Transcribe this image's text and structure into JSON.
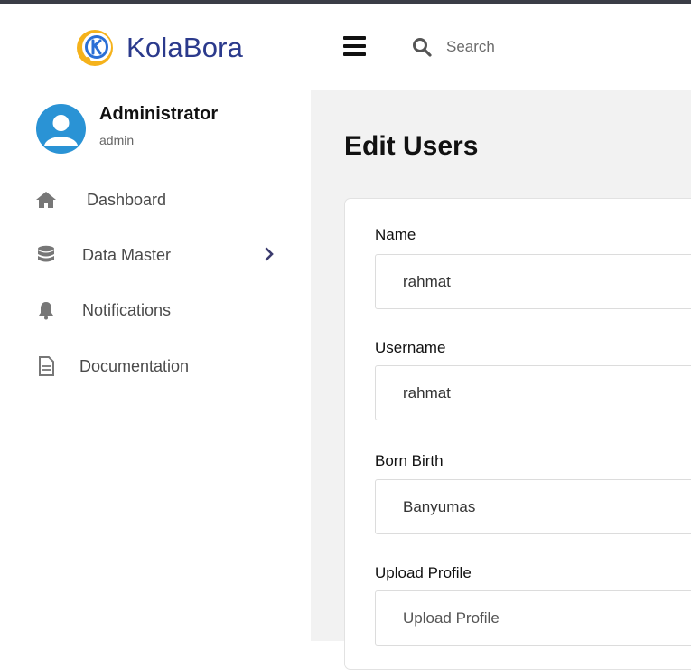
{
  "header": {
    "brand_name": "KolaBora",
    "search_placeholder": "Search",
    "brand_colors": {
      "primary": "#2b3a8c",
      "accent": "#f5b21b"
    }
  },
  "sidebar": {
    "user": {
      "name": "Administrator",
      "role": "admin"
    },
    "items": [
      {
        "label": "Dashboard",
        "icon": "home-icon"
      },
      {
        "label": "Data Master",
        "icon": "database-icon",
        "has_submenu": true
      },
      {
        "label": "Notifications",
        "icon": "bell-icon"
      },
      {
        "label": "Documentation",
        "icon": "document-icon"
      }
    ]
  },
  "main": {
    "title": "Edit Users",
    "form": {
      "name": {
        "label": "Name",
        "value": "rahmat"
      },
      "username": {
        "label": "Username",
        "value": "rahmat"
      },
      "born_birth": {
        "label": "Born Birth",
        "value": "Banyumas"
      },
      "upload_profile": {
        "label": "Upload Profile",
        "placeholder": "Upload Profile"
      }
    }
  }
}
